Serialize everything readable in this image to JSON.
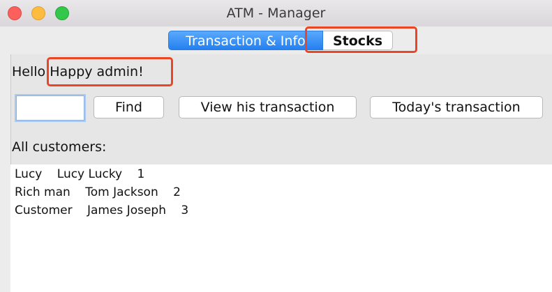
{
  "window": {
    "title": "ATM - Manager"
  },
  "tabs": [
    {
      "label": "Transaction & Info",
      "active": true
    },
    {
      "label": "Stocks",
      "active": false
    }
  ],
  "greeting": {
    "text": "Hello Happy admin!"
  },
  "search": {
    "value": ""
  },
  "buttons": {
    "find": "Find",
    "view_transaction": "View his transaction",
    "today_transaction": "Today's transaction"
  },
  "customers": {
    "label": "All customers:",
    "rows": [
      {
        "username": "Lucy",
        "name": "Lucy Lucky",
        "id": "1"
      },
      {
        "username": "Rich man",
        "name": "Tom Jackson",
        "id": "2"
      },
      {
        "username": "Customer",
        "name": "James Joseph",
        "id": "3"
      }
    ]
  },
  "colors": {
    "tab_active": "#2480f0",
    "highlight": "#ea4525"
  }
}
